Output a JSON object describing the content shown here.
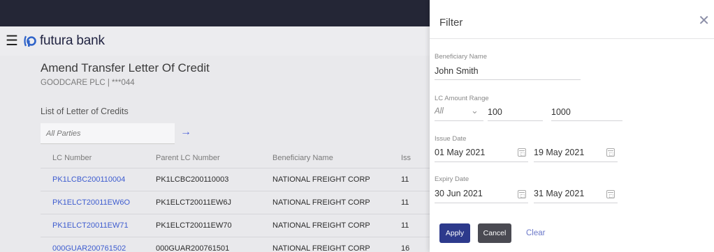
{
  "brand": {
    "name": "futura bank"
  },
  "page": {
    "title": "Amend Transfer Letter Of Credit",
    "subtitle": "GOODCARE PLC | ***044",
    "list_title": "List of Letter of Credits",
    "party_select": "All Parties"
  },
  "table": {
    "headers": [
      "LC Number",
      "Parent LC Number",
      "Beneficiary Name",
      "Iss"
    ],
    "rows": [
      {
        "lc": "PK1LCBC200110004",
        "parent": "PK1LCBC200110003",
        "beneficiary": "NATIONAL FREIGHT CORP",
        "issue": "11"
      },
      {
        "lc": "PK1ELCT20011EW6O",
        "parent": "PK1ELCT20011EW6J",
        "beneficiary": "NATIONAL FREIGHT CORP",
        "issue": "11"
      },
      {
        "lc": "PK1ELCT20011EW71",
        "parent": "PK1ELCT20011EW70",
        "beneficiary": "NATIONAL FREIGHT CORP",
        "issue": "11"
      },
      {
        "lc": "000GUAR200761502",
        "parent": "000GUAR200761501",
        "beneficiary": "NATIONAL FREIGHT CORP",
        "issue": "16"
      }
    ]
  },
  "filter": {
    "title": "Filter",
    "beneficiary_label": "Beneficiary Name",
    "beneficiary_value": "John Smith",
    "amount_label": "LC Amount Range",
    "currency_value": "All",
    "amount_from": "100",
    "amount_to": "1000",
    "issue_label": "Issue Date",
    "issue_from": "01 May 2021",
    "issue_to": "19 May 2021",
    "expiry_label": "Expiry Date",
    "expiry_from": "30 Jun 2021",
    "expiry_to": "31 May 2021",
    "apply_label": "Apply",
    "cancel_label": "Cancel",
    "clear_label": "Clear"
  },
  "colors": {
    "topbar": "#242636",
    "link": "#3d5ccf",
    "apply": "#2d3a8c",
    "cancel": "#4a4a52"
  }
}
